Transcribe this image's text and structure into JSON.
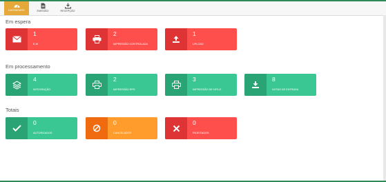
{
  "tabs": [
    {
      "label": "DASHBOARD",
      "icon": "dashboard-icon",
      "active": true
    },
    {
      "label": "EMISSÃO",
      "icon": "document-icon",
      "active": false
    },
    {
      "label": "RECEPÇÃO",
      "icon": "download-icon",
      "active": false
    }
  ],
  "sections": {
    "waiting": {
      "title": "Em espera",
      "cards": [
        {
          "count": "1",
          "label": "E-M",
          "icon": "envelope-icon",
          "color": "#fe4f4d"
        },
        {
          "count": "2",
          "label": "IMPRESSÃO CONTROLADA",
          "icon": "printer-icon",
          "color": "#fe4f4d"
        },
        {
          "count": "1",
          "label": "UPLOAD",
          "icon": "upload-icon",
          "color": "#fe4f4d"
        }
      ]
    },
    "processing": {
      "title": "Em processamento",
      "cards": [
        {
          "count": "4",
          "label": "INTEGRAÇÃO",
          "icon": "layers-icon",
          "color": "#3bc793"
        },
        {
          "count": "2",
          "label": "IMPRESSÃO RPS",
          "icon": "printer-icon",
          "color": "#3bc793"
        },
        {
          "count": "3",
          "label": "IMPRESSÃO DE NFS-E",
          "icon": "printer-icon",
          "color": "#3bc793"
        },
        {
          "count": "8",
          "label": "NOTAS DE ENTRADA",
          "icon": "download-tray-icon",
          "color": "#3bc793"
        }
      ]
    },
    "totals": {
      "title": "Totais",
      "cards": [
        {
          "count": "0",
          "label": "AUTORIZADOS",
          "icon": "check-icon",
          "color": "#3bc793"
        },
        {
          "count": "0",
          "label": "CANCELADOS",
          "icon": "ban-icon",
          "color": "#ff9c2b"
        },
        {
          "count": "0",
          "label": "REJEITADOS",
          "icon": "x-icon",
          "color": "#fe4f4d"
        }
      ]
    }
  }
}
